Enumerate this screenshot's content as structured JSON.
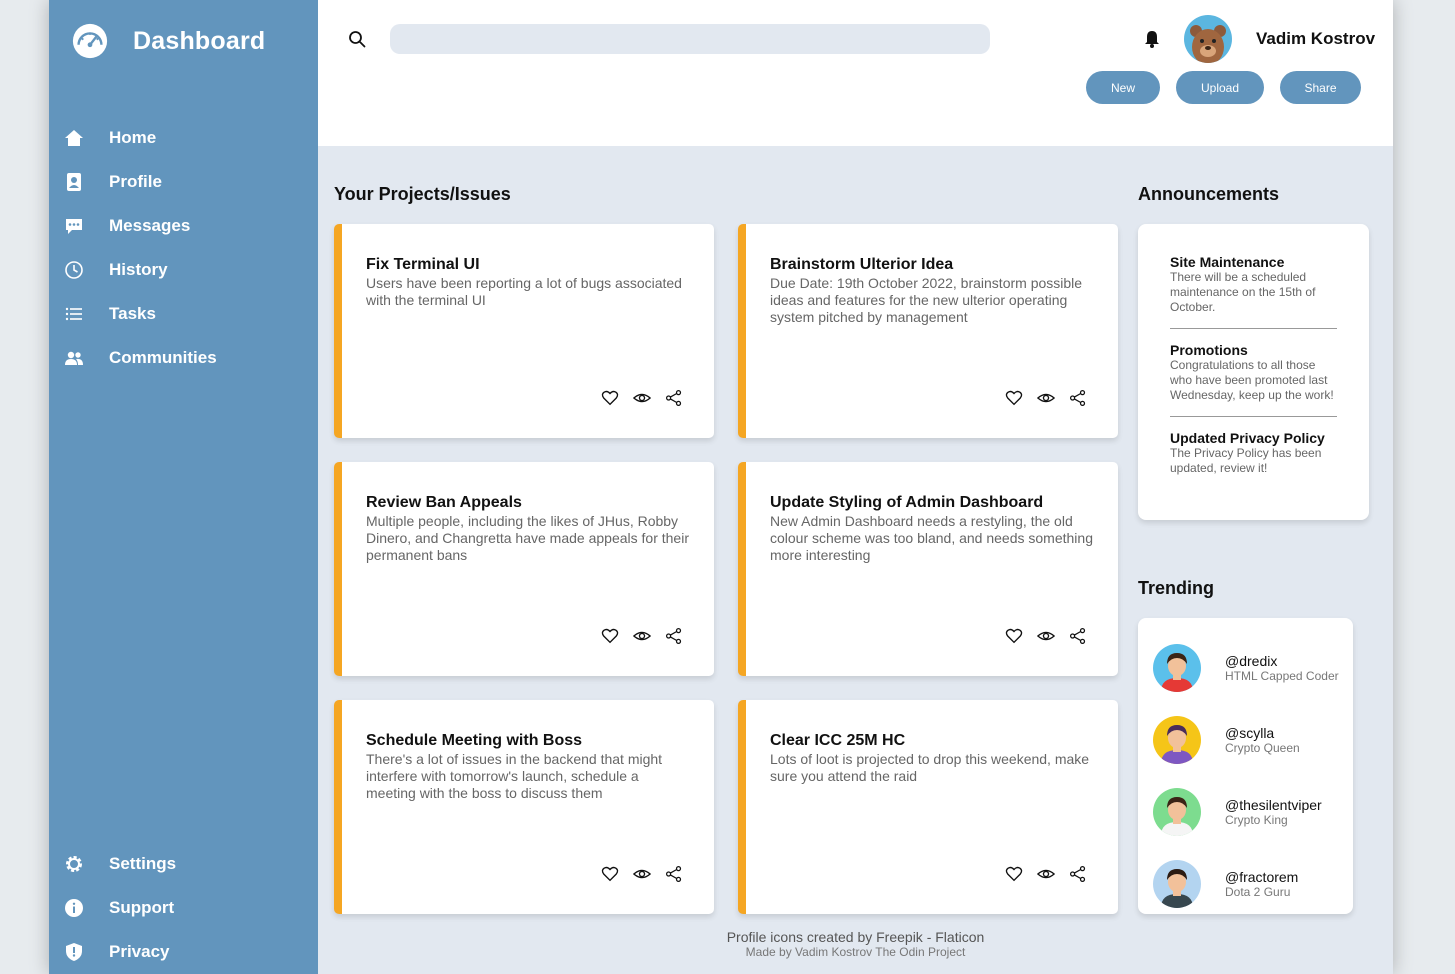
{
  "sidebar": {
    "title": "Dashboard",
    "items": [
      {
        "label": "Home",
        "icon": "home-icon"
      },
      {
        "label": "Profile",
        "icon": "profile-icon"
      },
      {
        "label": "Messages",
        "icon": "messages-icon"
      },
      {
        "label": "History",
        "icon": "history-icon"
      },
      {
        "label": "Tasks",
        "icon": "tasks-icon"
      },
      {
        "label": "Communities",
        "icon": "communities-icon"
      }
    ],
    "bottom_items": [
      {
        "label": "Settings",
        "icon": "gear-icon"
      },
      {
        "label": "Support",
        "icon": "info-icon"
      },
      {
        "label": "Privacy",
        "icon": "shield-icon"
      }
    ]
  },
  "header": {
    "search_placeholder": "",
    "username": "Vadim Kostrov",
    "buttons": {
      "new": "New",
      "upload": "Upload",
      "share": "Share"
    }
  },
  "projects": {
    "title": "Your Projects/Issues",
    "cards": [
      {
        "title": "Fix Terminal UI",
        "desc": "Users have been reporting a lot of bugs associated with the terminal UI"
      },
      {
        "title": "Brainstorm Ulterior Idea",
        "desc": "Due Date: 19th October 2022, brainstorm possible ideas and features for the new ulterior operating system pitched by management"
      },
      {
        "title": "Review Ban Appeals",
        "desc": "Multiple people, including the likes of JHus, Robby Dinero, and Changretta have made appeals for their permanent bans"
      },
      {
        "title": "Update Styling of Admin Dashboard",
        "desc": "New Admin Dashboard needs a restyling, the old colour scheme was too bland, and needs something more interesting"
      },
      {
        "title": "Schedule Meeting with Boss",
        "desc": "There's a lot of issues in the backend that might interfere with tomorrow's launch, schedule a meeting with the boss to discuss them"
      },
      {
        "title": "Clear ICC 25M HC",
        "desc": "Lots of loot is projected to drop this weekend, make sure you attend the raid"
      }
    ]
  },
  "announcements": {
    "title": "Announcements",
    "items": [
      {
        "title": "Site Maintenance",
        "text": "There will be a scheduled maintenance on the 15th of October."
      },
      {
        "title": "Promotions",
        "text": "Congratulations to all those who have been promoted last Wednesday, keep up the work!"
      },
      {
        "title": "Updated Privacy Policy",
        "text": "The Privacy Policy has been updated, review it!"
      }
    ]
  },
  "trending": {
    "title": "Trending",
    "items": [
      {
        "handle": "@dredix",
        "role": "HTML Capped Coder",
        "bg": "#5bc0eb",
        "shirt": "#e53935",
        "hair": "#3b2416"
      },
      {
        "handle": "@scylla",
        "role": "Crypto Queen",
        "bg": "#f5c518",
        "shirt": "#7e57c2",
        "hair": "#4a2c5a"
      },
      {
        "handle": "@thesilentviper",
        "role": "Crypto King",
        "bg": "#7ddc8f",
        "shirt": "#f5f5f5",
        "hair": "#3b2416"
      },
      {
        "handle": "@fractorem",
        "role": "Dota 2 Guru",
        "bg": "#b3d4f0",
        "shirt": "#37474f",
        "hair": "#2b1b12"
      }
    ]
  },
  "footer": {
    "line1": "Profile icons created by Freepik - Flaticon",
    "line2": "Made by Vadim Kostrov The Odin Project"
  },
  "colors": {
    "sidebar": "#6295bd",
    "accent": "#f5a623",
    "background": "#e2e8f0"
  }
}
